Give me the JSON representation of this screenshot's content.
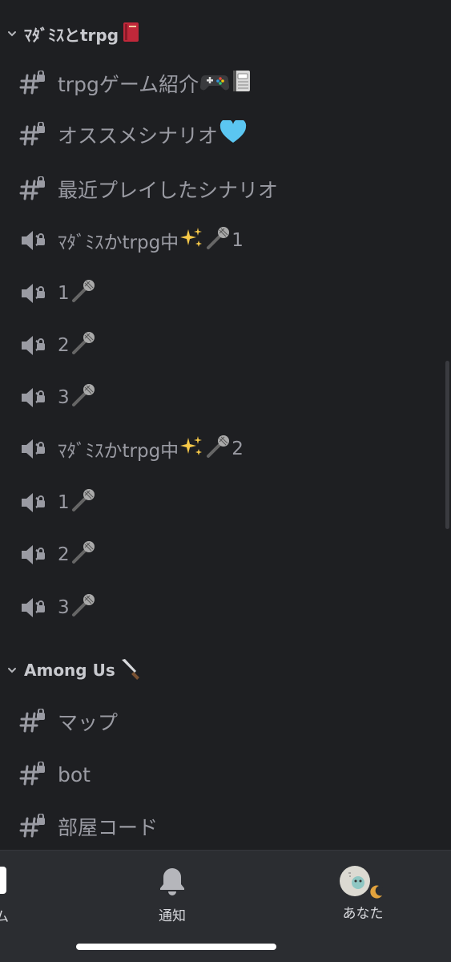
{
  "categories": [
    {
      "name": "ﾏﾀﾞﾐｽとtrpg",
      "emoji": "book-icon",
      "channels": [
        {
          "type": "text",
          "label": "trpgゲーム紹介"
        },
        {
          "type": "text",
          "label": "オススメシナリオ"
        },
        {
          "type": "text",
          "label": "最近プレイしたシナリオ"
        },
        {
          "type": "voice",
          "label": "ﾏﾀﾞﾐｽかtrpg中",
          "suffix": "1"
        },
        {
          "type": "voice",
          "label": "1"
        },
        {
          "type": "voice",
          "label": "2"
        },
        {
          "type": "voice",
          "label": "3"
        },
        {
          "type": "voice",
          "label": "ﾏﾀﾞﾐｽかtrpg中",
          "suffix": "2"
        },
        {
          "type": "voice",
          "label": "1"
        },
        {
          "type": "voice",
          "label": "2"
        },
        {
          "type": "voice",
          "label": "3"
        }
      ]
    },
    {
      "name": "Among Us",
      "emoji": "knife-icon",
      "channels": [
        {
          "type": "text",
          "label": "マップ"
        },
        {
          "type": "text",
          "label": "bot"
        },
        {
          "type": "text",
          "label": "部屋コード"
        }
      ]
    }
  ],
  "tabbar": {
    "home_label": "ム",
    "notifications_label": "通知",
    "you_label": "あなた"
  },
  "colors": {
    "background": "#1e1f22",
    "tabbar": "#2b2d31",
    "channel_text": "#9a9ba3",
    "category_text": "#c8c9ce"
  }
}
